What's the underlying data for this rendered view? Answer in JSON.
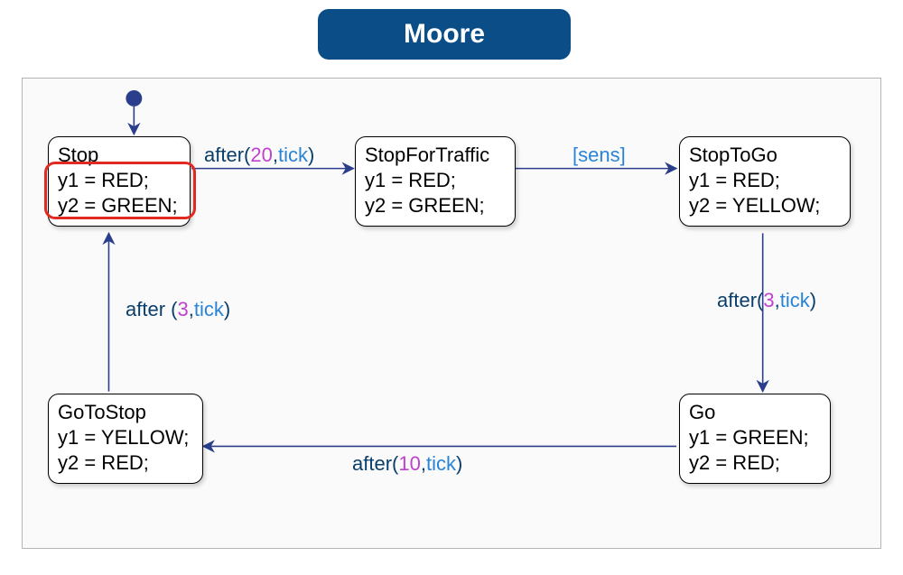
{
  "title": "Moore",
  "states": {
    "stop": {
      "name": "Stop",
      "line1": "y1 = RED;",
      "line2": "y2 = GREEN;"
    },
    "stopfortraffic": {
      "name": "StopForTraffic",
      "line1": "y1 = RED;",
      "line2": "y2 = GREEN;"
    },
    "stoptogo": {
      "name": "StopToGo",
      "line1": "y1 = RED;",
      "line2": "y2 = YELLOW;"
    },
    "go": {
      "name": "Go",
      "line1": "y1 = GREEN;",
      "line2": "y2 = RED;"
    },
    "gotostop": {
      "name": "GoToStop",
      "line1": "y1 = YELLOW;",
      "line2": "y2 = RED;"
    }
  },
  "transitions": {
    "stop_to_sft": {
      "kw": "after",
      "lp": "(",
      "arg1": "20",
      "sep": ",",
      "arg2": "tick",
      "rp": ")"
    },
    "sft_to_stoptogo": {
      "lb": "[",
      "cond": "sens",
      "rb": "]"
    },
    "stoptogo_to_go": {
      "kw": "after",
      "lp": "(",
      "arg1": "3",
      "sep": ",",
      "arg2": "tick",
      "rp": ")"
    },
    "go_to_gotostop": {
      "kw": "after",
      "lp": "(",
      "arg1": "10",
      "sep": ",",
      "arg2": "tick",
      "rp": ")"
    },
    "gotostop_to_stop": {
      "kw": "after ",
      "lp": "(",
      "arg1": "3",
      "sep": ",",
      "arg2": "tick",
      "rp": ")"
    }
  },
  "chart_data": {
    "type": "state_machine",
    "title": "Moore",
    "initial_state": "Stop",
    "states": [
      {
        "id": "Stop",
        "outputs": {
          "y1": "RED",
          "y2": "GREEN"
        },
        "highlighted": true
      },
      {
        "id": "StopForTraffic",
        "outputs": {
          "y1": "RED",
          "y2": "GREEN"
        }
      },
      {
        "id": "StopToGo",
        "outputs": {
          "y1": "RED",
          "y2": "YELLOW"
        }
      },
      {
        "id": "Go",
        "outputs": {
          "y1": "GREEN",
          "y2": "RED"
        }
      },
      {
        "id": "GoToStop",
        "outputs": {
          "y1": "YELLOW",
          "y2": "RED"
        }
      }
    ],
    "transitions": [
      {
        "from": "Stop",
        "to": "StopForTraffic",
        "trigger": "after(20,tick)"
      },
      {
        "from": "StopForTraffic",
        "to": "StopToGo",
        "guard": "[sens]"
      },
      {
        "from": "StopToGo",
        "to": "Go",
        "trigger": "after(3,tick)"
      },
      {
        "from": "Go",
        "to": "GoToStop",
        "trigger": "after(10,tick)"
      },
      {
        "from": "GoToStop",
        "to": "Stop",
        "trigger": "after (3,tick)"
      }
    ]
  }
}
